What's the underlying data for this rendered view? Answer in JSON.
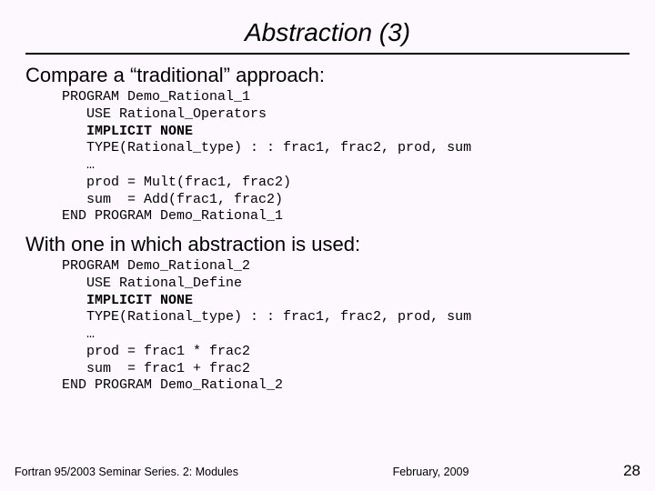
{
  "title": "Abstraction (3)",
  "lead1": "Compare a “traditional” approach:",
  "code1": {
    "l1": "PROGRAM Demo_Rational_1",
    "l2": "   USE Rational_Operators",
    "l3a": "   ",
    "l3b": "IMPLICIT NONE",
    "l4": "   TYPE(Rational_type) : : frac1, frac2, prod, sum",
    "l5": "   …",
    "l6": "   prod = Mult(frac1, frac2)",
    "l7": "   sum  = Add(frac1, frac2)",
    "l8": "END PROGRAM Demo_Rational_1"
  },
  "lead2": "With one in which abstraction is used:",
  "code2": {
    "l1": "PROGRAM Demo_Rational_2",
    "l2": "   USE Rational_Define",
    "l3a": "   ",
    "l3b": "IMPLICIT NONE",
    "l4": "   TYPE(Rational_type) : : frac1, frac2, prod, sum",
    "l5": "   …",
    "l6": "   prod = frac1 * frac2",
    "l7": "   sum  = frac1 + frac2",
    "l8": "END PROGRAM Demo_Rational_2"
  },
  "footer": {
    "left": "Fortran 95/2003 Seminar Series. 2: Modules",
    "center": "February, 2009",
    "page": "28"
  }
}
